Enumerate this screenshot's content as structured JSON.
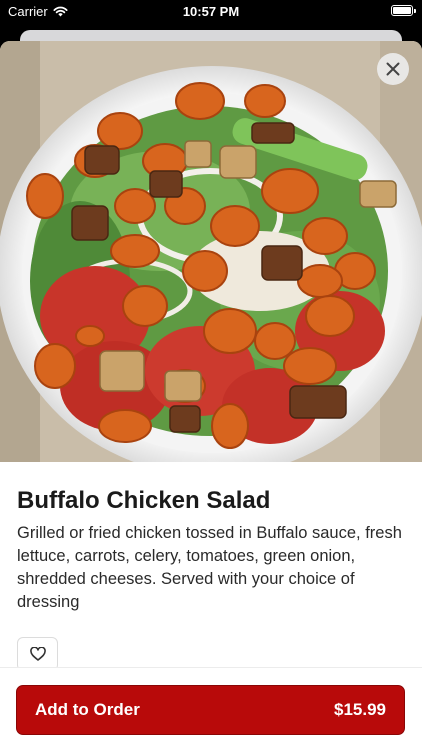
{
  "status_bar": {
    "carrier": "Carrier",
    "time": "10:57 PM",
    "wifi_icon": "wifi-icon",
    "battery_icon": "battery-icon"
  },
  "item": {
    "photo_icon": "food-photo",
    "name": "Buffalo Chicken Salad",
    "description": "Grilled or fried chicken tossed in Buffalo sauce, fresh lettuce, carrots, celery, tomatoes, green onion, shredded cheeses. Served with your choice of dressing"
  },
  "actions": {
    "close_icon": "close-icon",
    "favorite_icon": "heart-icon"
  },
  "footer": {
    "add_label": "Add to Order",
    "price": "$15.99"
  },
  "colors": {
    "accent": "#b80a0a",
    "sauce": "#d8651e",
    "lettuce": "#6aa24a",
    "tomato": "#c8352a"
  }
}
